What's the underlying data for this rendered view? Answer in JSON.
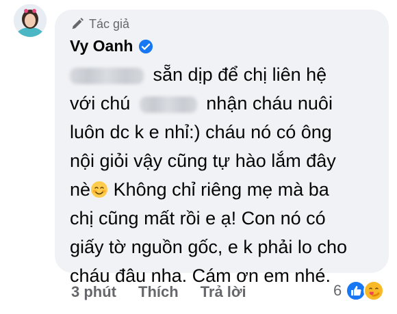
{
  "author": {
    "badge_label": "Tác giả",
    "name": "Vy Oanh",
    "verified": true
  },
  "comment": {
    "lines": [
      "sẵn dịp để chị liên hệ",
      "với chú",
      "nhận cháu nuôi",
      "luôn dc k e nhỉ:) cháu nó có ông",
      "nội giỏi vậy cũng tự hào lắm đây",
      "nè",
      "Không chỉ riêng mẹ mà ba",
      "chị cũng mất rồi e ạ! Con nó có",
      "giấy tờ nguồn gốc, e k phải lo cho",
      "cháu đâu nha. Cám ơn em nhé."
    ],
    "inline_emoji": "smiling-face-icon"
  },
  "actions": {
    "time": "3 phút",
    "like": "Thích",
    "reply": "Trả lời"
  },
  "reactions": {
    "count": "6",
    "types": [
      "like-icon",
      "care-icon"
    ]
  },
  "colors": {
    "bubble": "#f0f2f5",
    "secondary_text": "#65676b",
    "primary_text": "#050505",
    "like_blue": "#1877f2",
    "care_yellow": "#f7b928"
  }
}
